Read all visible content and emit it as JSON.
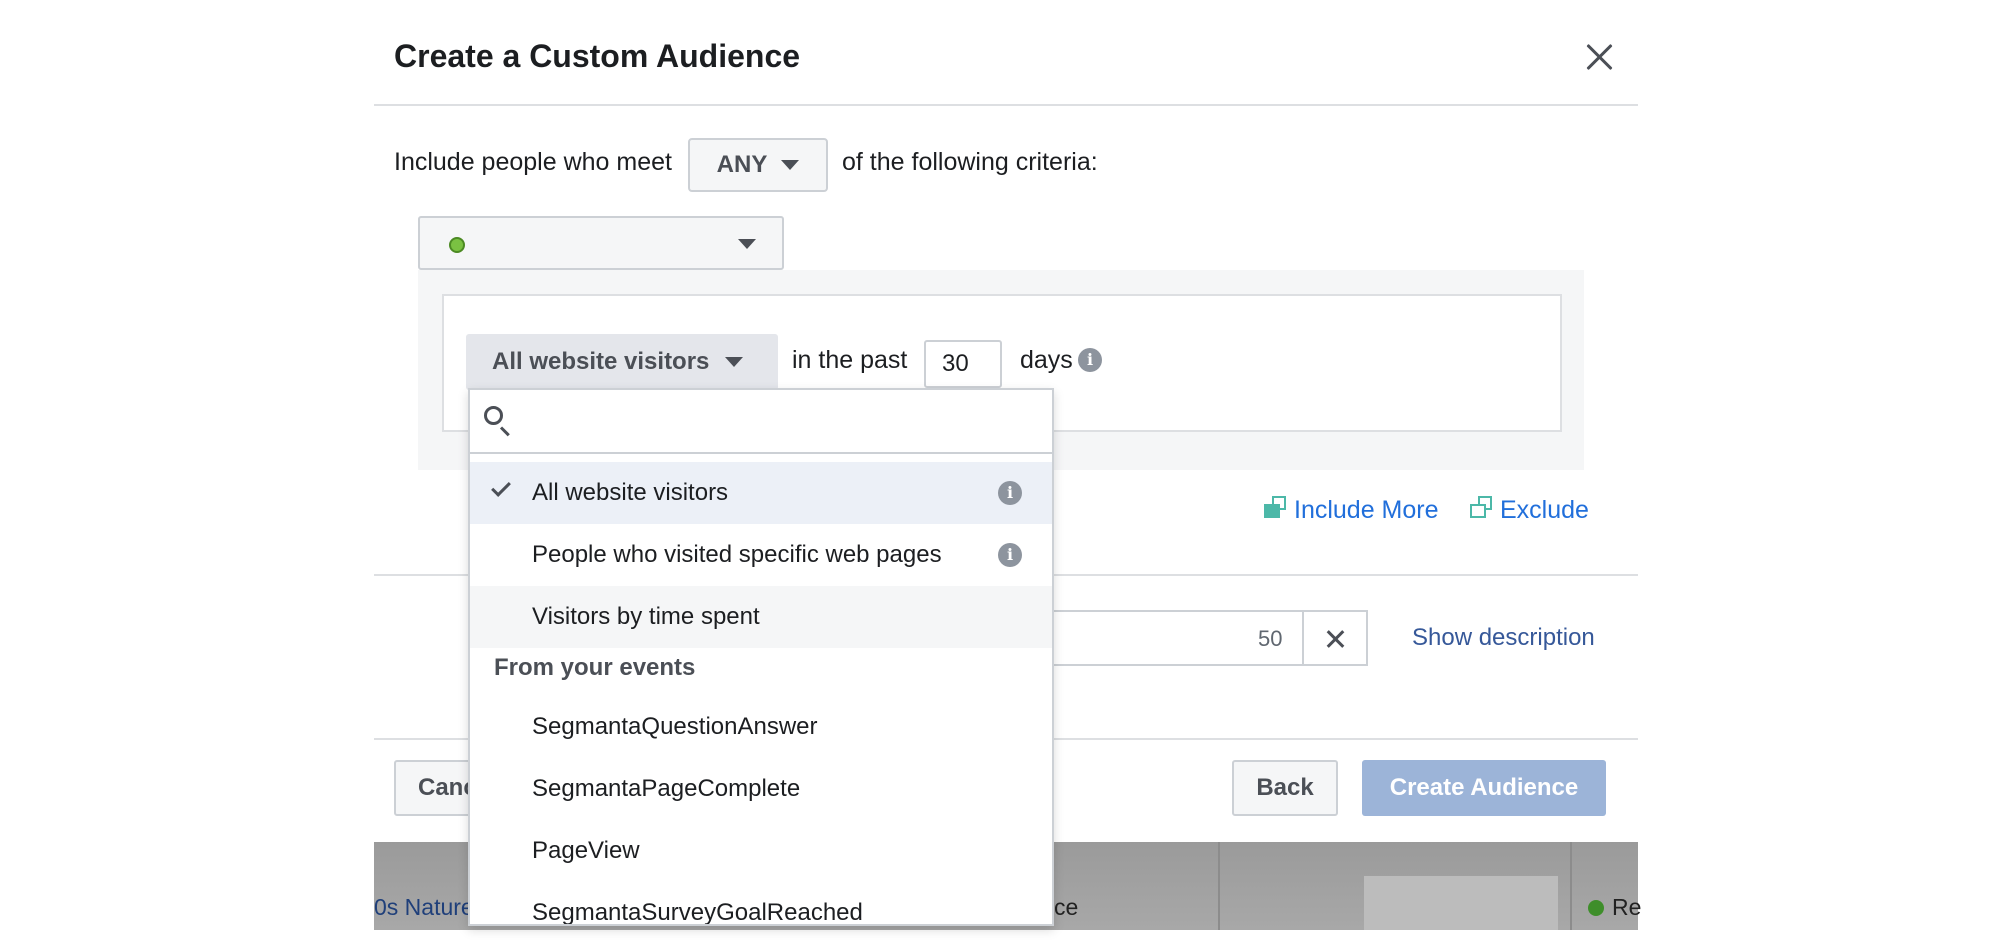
{
  "dialog": {
    "title": "Create a Custom Audience",
    "criteria": {
      "prefix": "Include people who meet",
      "match_value": "ANY",
      "suffix": "of the following criteria:"
    },
    "rule": {
      "visitor_type": "All website visitors",
      "in_the_past": "in the past",
      "days_value": "30",
      "days_label": "days"
    },
    "links": {
      "include_more": "Include More",
      "exclude": "Exclude"
    },
    "name": {
      "char_count": "50",
      "show_description": "Show description"
    },
    "footer": {
      "cancel": "Cancel",
      "back": "Back",
      "create": "Create Audience"
    }
  },
  "dropdown": {
    "search_placeholder": "",
    "items": [
      {
        "label": "All website visitors",
        "selected": true,
        "info": true
      },
      {
        "label": "People who visited specific web pages",
        "selected": false,
        "info": true
      },
      {
        "label": "Visitors by time spent",
        "selected": false,
        "info": false
      }
    ],
    "section_header": "From your events",
    "events": [
      "SegmantaQuestionAnswer",
      "SegmantaPageComplete",
      "PageView",
      "SegmantaSurveyGoalReached"
    ]
  },
  "background": {
    "cell_left": "0s Nature",
    "cell_mid": "ce",
    "cell_right": "Re"
  },
  "colors": {
    "link": "#216fdb",
    "primary_disabled": "#9cb4d8",
    "status_green": "#7ac142"
  }
}
